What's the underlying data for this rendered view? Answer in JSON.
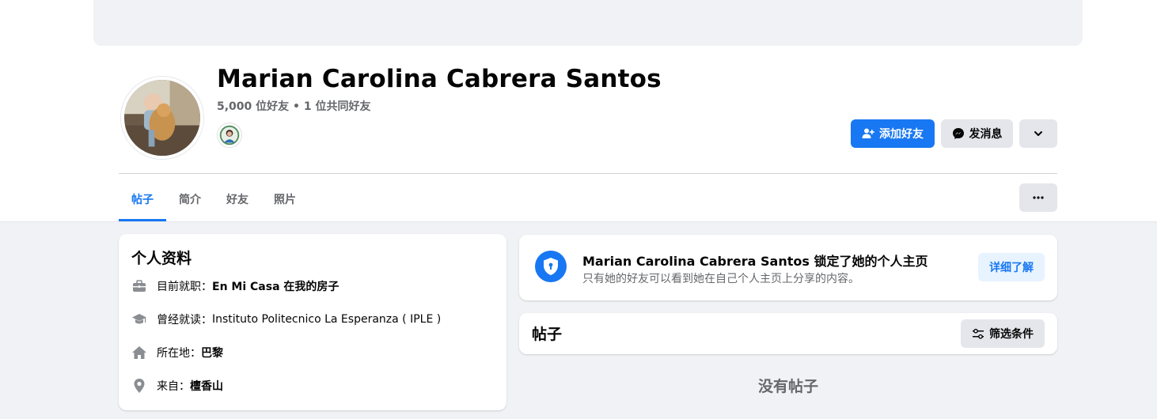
{
  "profile": {
    "name": "Marian Carolina Cabrera Santos",
    "friends_text": "5,000 位好友 • 1 位共同好友"
  },
  "actions": {
    "add_friend": "添加好友",
    "message": "发消息"
  },
  "tabs": [
    {
      "label": "帖子",
      "active": true
    },
    {
      "label": "简介",
      "active": false
    },
    {
      "label": "好友",
      "active": false
    },
    {
      "label": "照片",
      "active": false
    }
  ],
  "intro": {
    "title": "个人资料",
    "rows": [
      {
        "icon": "briefcase-icon",
        "label": "目前就职：",
        "value": "En Mi Casa 在我的房子"
      },
      {
        "icon": "graduation-cap-icon",
        "label": "曾经就读：",
        "value": "Instituto Politecnico La Esperanza ( IPLE )"
      },
      {
        "icon": "home-icon",
        "label": "所在地：",
        "value": "巴黎"
      },
      {
        "icon": "location-pin-icon",
        "label": "来自：",
        "value": "檀香山"
      }
    ]
  },
  "locked": {
    "title": "Marian Carolina Cabrera Santos 锁定了她的个人主页",
    "subtitle": "只有她的好友可以看到她在自己个人主页上分享的内容。",
    "learn_more": "详细了解"
  },
  "posts": {
    "title": "帖子",
    "filter_label": "筛选条件",
    "empty_text": "没有帖子"
  },
  "colors": {
    "accent": "#1877f2",
    "background": "#f0f2f5",
    "secondary_text": "#65676b",
    "button_gray": "#e4e6eb"
  }
}
